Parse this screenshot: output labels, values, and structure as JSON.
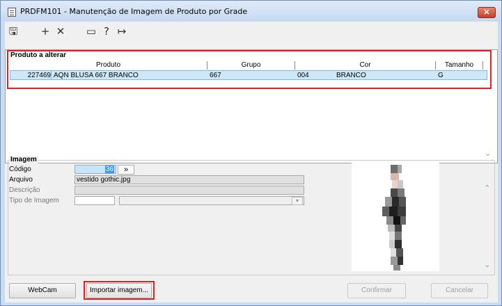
{
  "window": {
    "title": "PRDFM101 - Manutenção de Imagem de Produto por Grade",
    "close_label": "✕"
  },
  "toolbar": {
    "icons": [
      "save-icon",
      "add-icon",
      "delete-icon",
      "calendar-icon",
      "help-icon",
      "exit-icon"
    ]
  },
  "produto": {
    "section_title": "Produto a alterar",
    "columns": [
      "Produto",
      "Grupo",
      "Cor",
      "Tamanho"
    ],
    "row": {
      "codigo": "227469",
      "descricao": "AQN BLUSA 667 BRANCO",
      "grupo": "667",
      "cor_codigo": "004",
      "cor_nome": "BRANCO",
      "tamanho": "G"
    }
  },
  "imagem": {
    "section_title": "Imagem",
    "codigo_label": "Código",
    "codigo_value": "36",
    "lookup_label": "»",
    "arquivo_label": "Arquivo",
    "arquivo_value": "vestido gothic.jpg",
    "descricao_label": "Descrição",
    "descricao_value": "",
    "tipo_label": "Tipo de Imagem",
    "tipo_value": ""
  },
  "buttons": {
    "webcam": "WebCam",
    "importar": "Importar imagem...",
    "confirmar": "Confirmar",
    "cancelar": "Cancelar"
  },
  "colors": {
    "highlight_red": "#e02020",
    "selected_row": "#cde8f6",
    "title_bar": "#c6d9f0"
  }
}
